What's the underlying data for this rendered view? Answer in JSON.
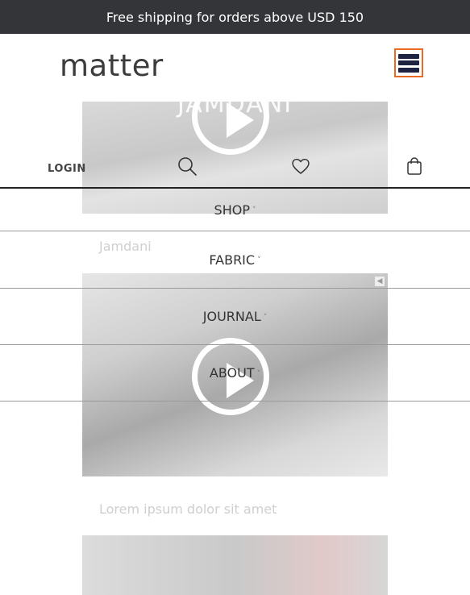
{
  "announcement": "Free shipping for orders above USD 150",
  "logo": "matter",
  "header": {
    "menu_icon": "hamburger-menu-icon"
  },
  "utility_bar": {
    "login": "LOGIN",
    "icons": [
      "search-icon",
      "heart-icon",
      "shopping-bag-icon"
    ]
  },
  "nav": {
    "items": [
      {
        "label": "SHOP",
        "caret": "˅"
      },
      {
        "label": "FABRIC",
        "caret": "˅"
      },
      {
        "label": "JOURNAL",
        "caret": "˅"
      },
      {
        "label": "ABOUT",
        "caret": "˅"
      }
    ]
  },
  "background": {
    "video_title": "JAMDANI",
    "captions": [
      "Jamdani",
      "Lorem ipsum dolor sit amet"
    ]
  },
  "colors": {
    "announce_bg": "#333539",
    "hamburger_border": "#ea6a24",
    "hamburger_bars": "#1d2340"
  }
}
